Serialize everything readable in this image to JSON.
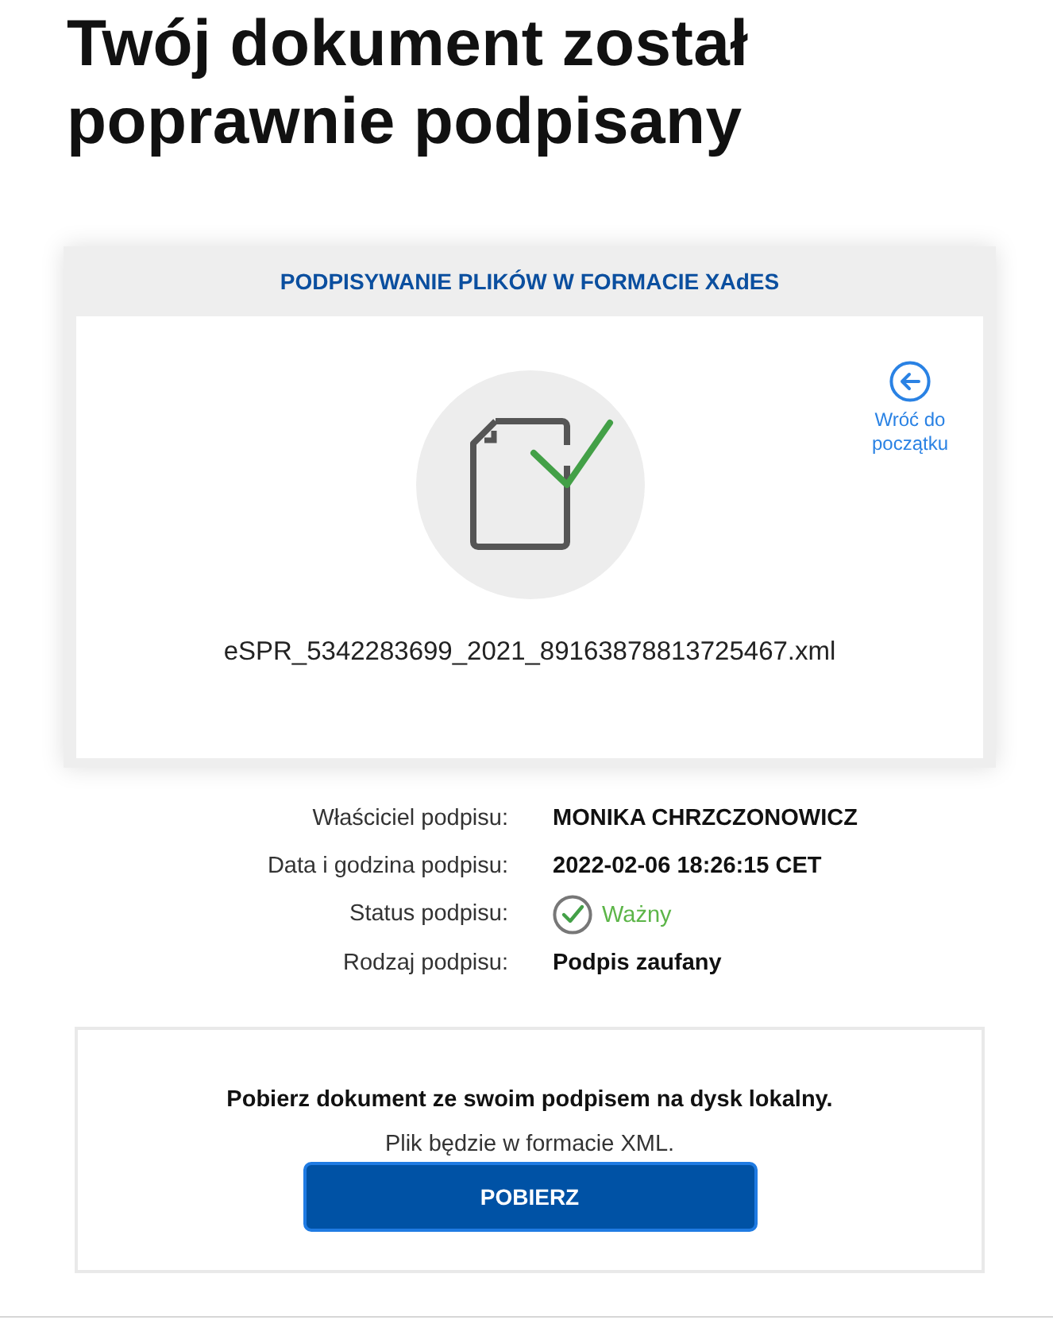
{
  "heading": "Twój dokument został poprawnie podpisany",
  "card": {
    "title": "PODPISYWANIE PLIKÓW W FORMACIE XAdES",
    "back_link": "Wróć do początku",
    "file_name": "eSPR_5342283699_2021_89163878813725467.xml"
  },
  "signature_details": [
    {
      "kind": "text",
      "label": "Właściciel podpisu:",
      "value": "MONIKA CHRZCZONOWICZ"
    },
    {
      "kind": "text",
      "label": "Data i godzina podpisu:",
      "value": "2022-02-06 18:26:15 CET"
    },
    {
      "kind": "status",
      "label": "Status podpisu:",
      "value": "Ważny",
      "valid": true
    },
    {
      "kind": "text",
      "label": "Rodzaj podpisu:",
      "value": "Podpis zaufany"
    }
  ],
  "download": {
    "message": "Pobierz dokument ze swoim podpisem na dysk lokalny.",
    "note": "Plik będzie w formacie XML.",
    "button": "POBIERZ"
  }
}
